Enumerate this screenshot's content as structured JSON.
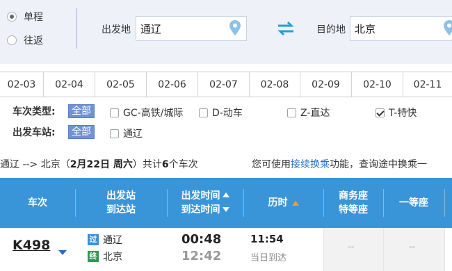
{
  "trip_type": {
    "one_way": "单程",
    "round_trip": "往返",
    "selected": "one_way"
  },
  "from": {
    "label": "出发地",
    "value": "通辽"
  },
  "to": {
    "label": "目的地",
    "value": "北京"
  },
  "dates": [
    "02-03",
    "02-04",
    "02-05",
    "02-06",
    "02-07",
    "02-08",
    "02-09",
    "02-10",
    "02-11"
  ],
  "filters": {
    "train_type_label": "车次类型:",
    "all_label": "全部",
    "types": [
      {
        "label": "GC-高铁/城际",
        "checked": false
      },
      {
        "label": "D-动车",
        "checked": false
      },
      {
        "label": "Z-直达",
        "checked": false
      },
      {
        "label": "T-特快",
        "checked": true
      }
    ],
    "station_label": "出发车站:",
    "station_all_label": "全部",
    "stations": [
      {
        "label": "通辽",
        "checked": false
      }
    ]
  },
  "route_summary": {
    "prefix": "通辽 --> 北京（",
    "date": "2月22日",
    "weekday": " 周六",
    "suffix": "）共计",
    "count": "6",
    "count_suffix": "个车次"
  },
  "transfer_hint": {
    "before": "您可使用",
    "link": "接续换乘",
    "after": "功能，查询途中换乘一"
  },
  "table_header": {
    "train": "车次",
    "station_dep": "出发站",
    "station_arr": "到达站",
    "time_dep": "出发时间",
    "time_arr": "到达时间",
    "duration": "历时",
    "business_1": "商务座",
    "business_2": "特等座",
    "first_class": "一等座"
  },
  "trains": [
    {
      "code": "K498",
      "from_badge": "过",
      "from_station": "通辽",
      "to_badge": "终",
      "to_station": "北京",
      "depart": "00:48",
      "arrive": "12:42",
      "duration": "11:54",
      "arrival_day": "当日到达",
      "business": "--",
      "first": "--"
    }
  ],
  "colors": {
    "accent": "#3a95d8",
    "pill": "#6f93d2",
    "pass_badge": "#3d8fd8",
    "end_badge": "#2f9a4c",
    "swap": "#2a9ad8"
  }
}
